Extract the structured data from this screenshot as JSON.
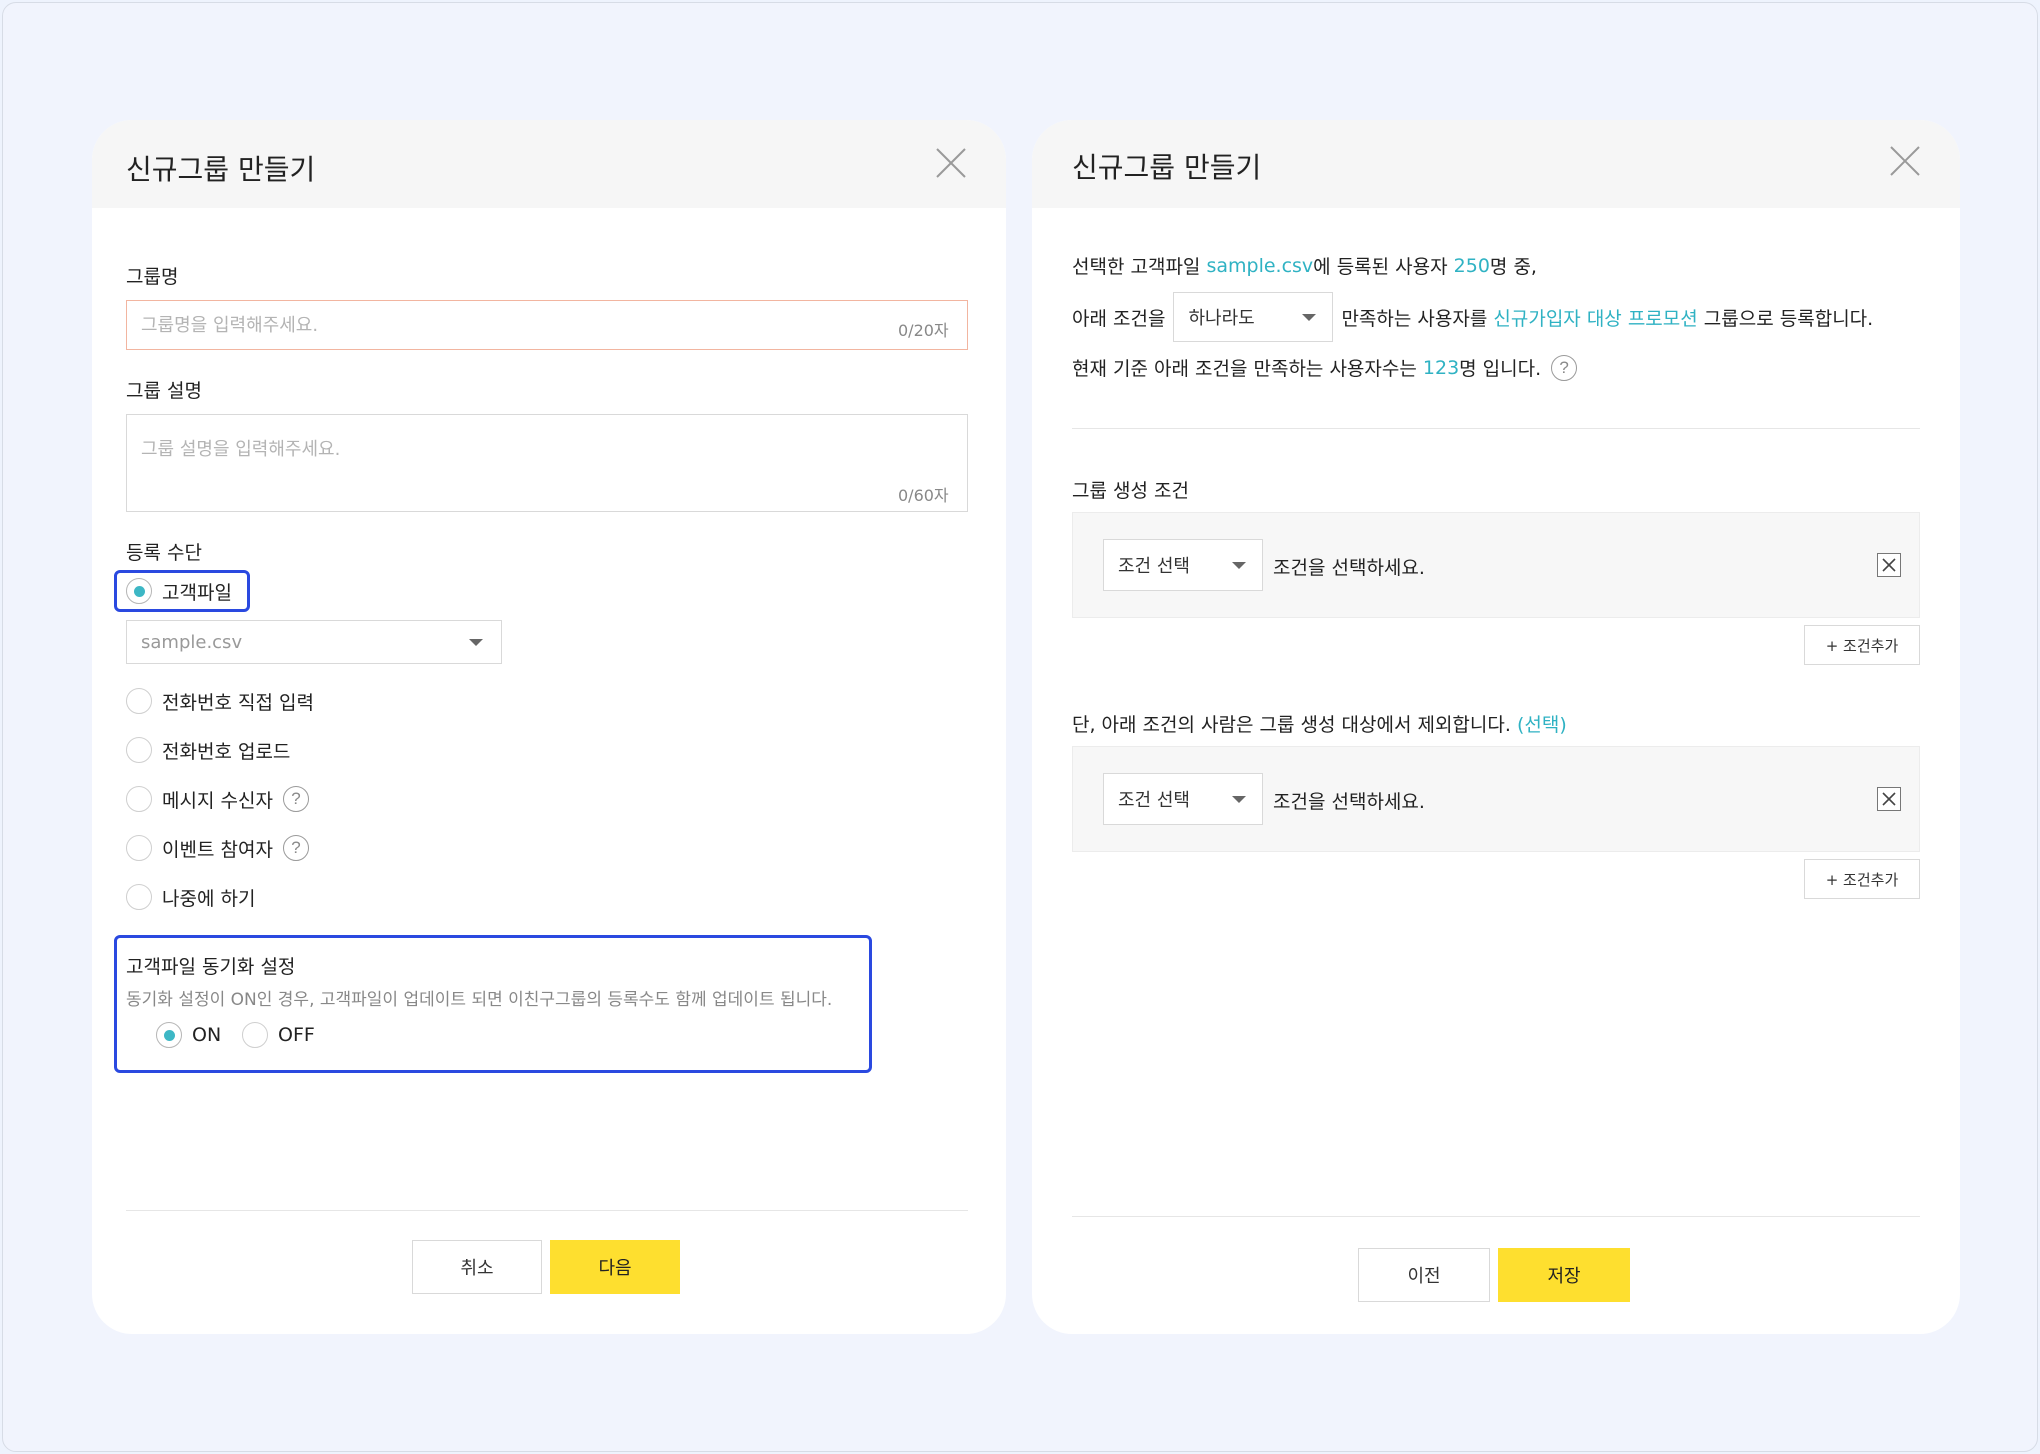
{
  "left_modal": {
    "title": "신규그룹 만들기",
    "group_name": {
      "label": "그룹명",
      "placeholder": "그룹명을 입력해주세요.",
      "counter": "0/20자"
    },
    "group_desc": {
      "label": "그룹 설명",
      "placeholder": "그룹 설명을 입력해주세요.",
      "counter": "0/60자"
    },
    "registration": {
      "label": "등록 수단",
      "options": [
        {
          "label": "고객파일",
          "checked": true
        },
        {
          "label": "전화번호 직접 입력",
          "checked": false
        },
        {
          "label": "전화번호 업로드",
          "checked": false
        },
        {
          "label": "메시지 수신자",
          "checked": false,
          "help": "?"
        },
        {
          "label": "이벤트 참여자",
          "checked": false,
          "help": "?"
        },
        {
          "label": "나중에 하기",
          "checked": false
        }
      ],
      "file_select_value": "sample.csv"
    },
    "sync": {
      "title": "고객파일 동기화 설정",
      "description": "동기화 설정이 ON인 경우, 고객파일이 업데이트 되면 이친구그룹의 등록수도 함께 업데이트 됩니다.",
      "on_label": "ON",
      "off_label": "OFF",
      "selected": "ON"
    },
    "buttons": {
      "cancel": "취소",
      "next": "다음"
    }
  },
  "right_modal": {
    "title": "신규그룹 만들기",
    "info": {
      "line1_prefix": "선택한 고객파일 ",
      "file_name": "sample.csv",
      "line1_mid": "에 등록된 사용자 ",
      "user_count": "250",
      "line1_suffix": "명 중,",
      "line2_prefix": "아래 조건을",
      "match_value": "하나라도",
      "line2_mid": "만족하는 사용자를 ",
      "group_name": "신규가입자 대상 프로모션",
      "line2_suffix": " 그룹으로 등록합니다.",
      "line3_prefix": "현재 기준 아래 조건을 만족하는 사용자수는 ",
      "match_count": "123",
      "line3_suffix": "명 입니다.",
      "help": "?"
    },
    "group_condition": {
      "label": "그룹 생성 조건",
      "select_value": "조건 선택",
      "hint": "조건을 선택하세요.",
      "add_label": "+ 조건추가"
    },
    "exclude_condition": {
      "label": "단, 아래 조건의 사람은 그룹 생성 대상에서 제외합니다. ",
      "optional": "(선택)",
      "select_value": "조건 선택",
      "hint": "조건을 선택하세요.",
      "add_label": "+ 조건추가"
    },
    "buttons": {
      "prev": "이전",
      "save": "저장"
    }
  },
  "colors": {
    "accent": "#2fb2c3",
    "primary_button": "#fedf2f",
    "highlight": "#2a49e0",
    "background": "#eef3fd"
  },
  "icons": {
    "close": "close-icon",
    "help": "help-icon",
    "caret": "chevron-down-icon",
    "remove": "remove-icon"
  }
}
